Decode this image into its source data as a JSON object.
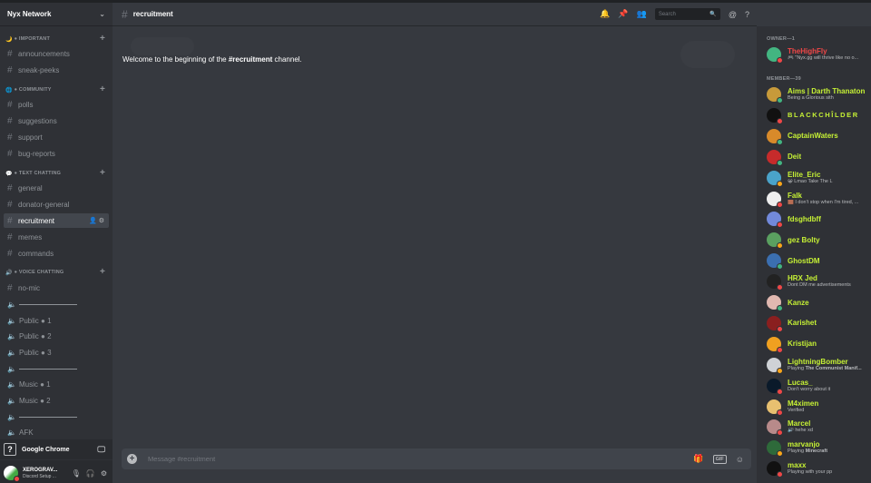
{
  "server": {
    "name": "Nyx Network"
  },
  "categories": [
    {
      "icon": "🌙",
      "label": "● IMPORTANT"
    },
    {
      "icon": "🌐",
      "label": "● COMMUNITY"
    },
    {
      "icon": "💬",
      "label": "● TEXT CHATTING"
    },
    {
      "icon": "🔊",
      "label": "● VOICE CHATTING"
    }
  ],
  "channels": {
    "important": [
      "announcements",
      "sneak-peeks"
    ],
    "community": [
      "polls",
      "suggestions",
      "support",
      "bug-reports"
    ],
    "text": [
      "general",
      "donator-general",
      "recruitment",
      "memes",
      "commands"
    ],
    "voice": [
      "no-mic",
      "",
      "Public ● 1",
      "Public ● 2",
      "Public ● 3",
      "",
      "Music ● 1",
      "Music ● 2",
      "",
      "AFK"
    ]
  },
  "activity": {
    "app": "Google Chrome"
  },
  "user": {
    "name": "XEROGRAV...",
    "status": "Discord Setup ..."
  },
  "header": {
    "channel": "recruitment",
    "search_placeholder": "Search"
  },
  "welcome": {
    "before": "Welcome to the beginning of the ",
    "channel": "#recruitment",
    "after": " channel."
  },
  "composer": {
    "placeholder": "Message #recruitment"
  },
  "members": {
    "owner_header": "OWNER—1",
    "member_header": "MEMBER—39",
    "owner": {
      "name": "TheHighFly",
      "status": "🎮 \"Nyx.gg will thrive like no o..."
    },
    "list": [
      {
        "name": "Aims | Darth Thanaton",
        "status": "Being a Glorious sith"
      },
      {
        "name": "BLACKCHÎLDER",
        "status": ""
      },
      {
        "name": "CaptainWaters",
        "status": ""
      },
      {
        "name": "Deit",
        "status": ""
      },
      {
        "name": "Elite_Eric",
        "status": "😀 Lmao Take The L"
      },
      {
        "name": "Falk",
        "status": "🟫 I don't stop when I'm tired, ..."
      },
      {
        "name": "fdsghdbff",
        "status": ""
      },
      {
        "name": "gez Bolty",
        "status": ""
      },
      {
        "name": "GhostDM",
        "status": ""
      },
      {
        "name": "HRX Jed",
        "status": "Dont DM me advertisements"
      },
      {
        "name": "Kanze",
        "status": ""
      },
      {
        "name": "Karishet",
        "status": ""
      },
      {
        "name": "Kristijan",
        "status": ""
      },
      {
        "name": "LightningBomber",
        "status_prefix": "Playing ",
        "status_bold": "The Communist Manif..."
      },
      {
        "name": "Lucas_",
        "status": "Don't worry about it"
      },
      {
        "name": "M4ximen",
        "status": "Verified"
      },
      {
        "name": "Marcel",
        "status": "🔊 hehe xd"
      },
      {
        "name": "marvanjo",
        "status_prefix": "Playing ",
        "status_bold": "Minecraft"
      },
      {
        "name": "maxx",
        "status": "Playing with your pp"
      }
    ]
  },
  "colors": {
    "member_name": "#c6f135",
    "owner_name": "#f04747",
    "online": "#43b581",
    "dnd": "#f04747",
    "idle": "#faa61a"
  }
}
